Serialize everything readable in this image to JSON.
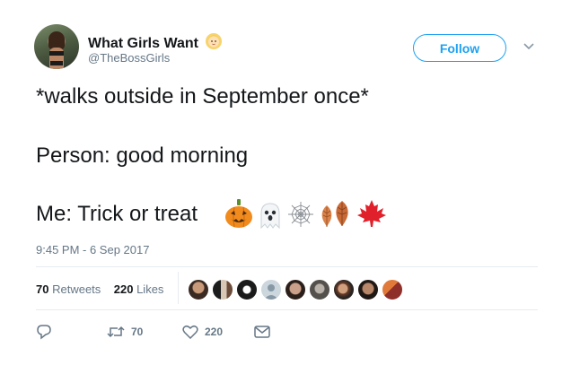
{
  "user": {
    "name": "What Girls Want",
    "handle": "@TheBossGirls",
    "verified_emoji": "blonde-girl-emoji"
  },
  "follow_button": {
    "label": "Follow"
  },
  "tweet": {
    "lines": [
      "*walks outside in September once*",
      "Person: good morning",
      "Me: Trick or treat"
    ],
    "emojis": [
      "jack-o-lantern-emoji",
      "ghost-emoji",
      "spider-web-emoji",
      "fallen-leaf-emoji",
      "fallen-leaf-emoji",
      "maple-leaf-emoji"
    ],
    "timestamp": "9:45 PM - 6 Sep 2017"
  },
  "stats": {
    "retweets_count": "70",
    "retweets_label": "Retweets",
    "likes_count": "220",
    "likes_label": "Likes"
  },
  "actions": {
    "reply_icon": "reply-icon",
    "retweet_count": "70",
    "like_count": "220",
    "dm_icon": "envelope-icon"
  },
  "colors": {
    "accent": "#1da1f2",
    "secondary_text": "#657786",
    "primary_text": "#14171a",
    "divider": "#e6ecf0"
  }
}
